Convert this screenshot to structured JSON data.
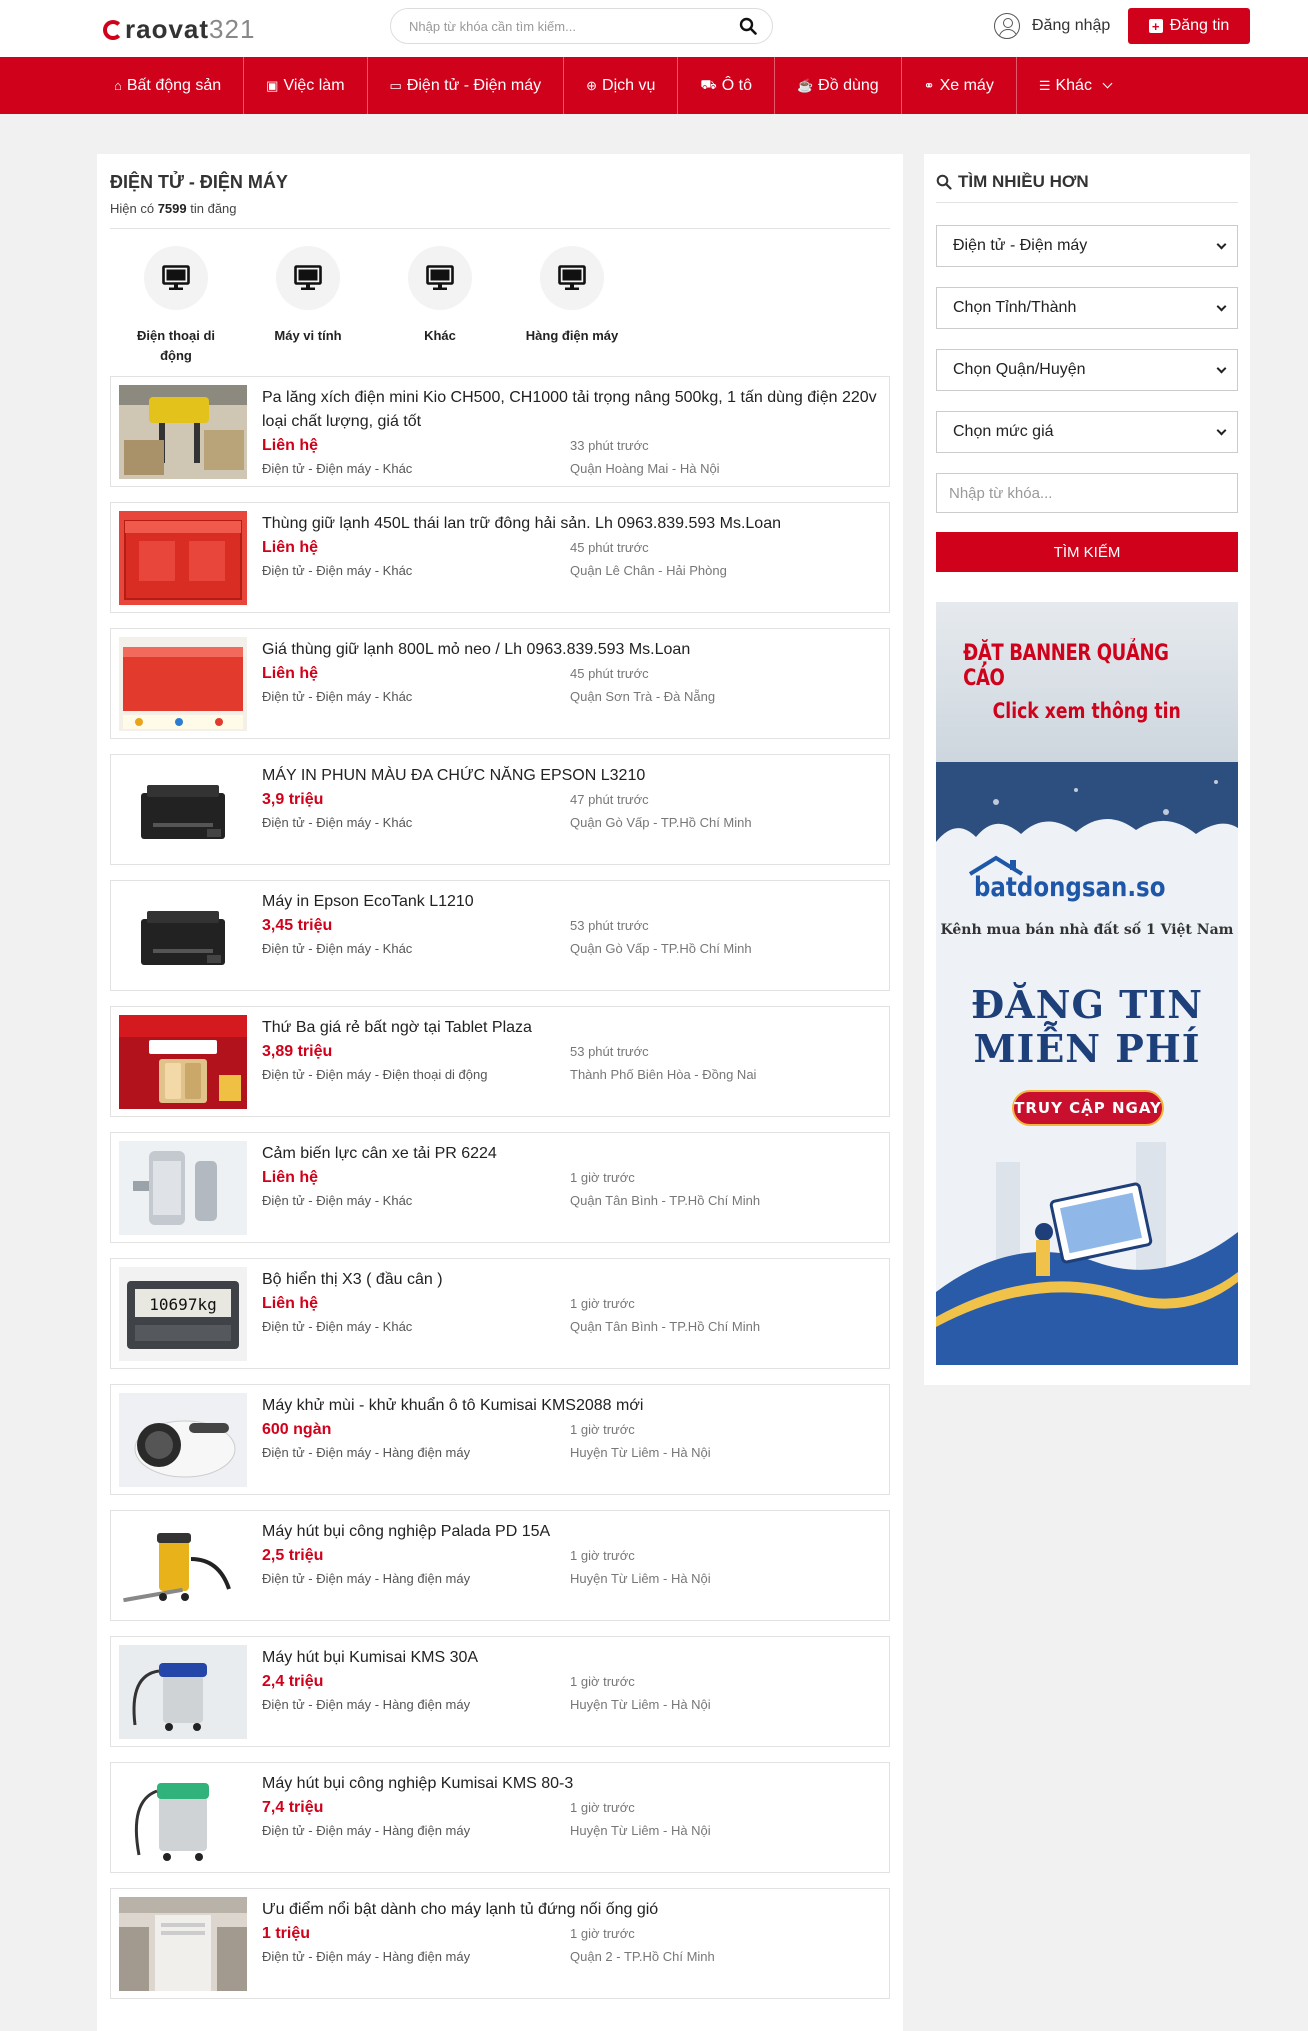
{
  "header": {
    "logo_text": "raovat",
    "logo_num": "321",
    "search_placeholder": "Nhập từ khóa cần tìm kiếm...",
    "login_label": "Đăng nhập",
    "post_label": "Đăng tin"
  },
  "nav": [
    {
      "label": "Bất động sản",
      "icon": "home-icon",
      "glyph": "⌂"
    },
    {
      "label": "Việc làm",
      "icon": "briefcase-icon",
      "glyph": "▣"
    },
    {
      "label": "Điện tử - Điện máy",
      "icon": "monitor-icon",
      "glyph": "▭"
    },
    {
      "label": "Dịch vụ",
      "icon": "globe-icon",
      "glyph": "⊕"
    },
    {
      "label": "Ô tô",
      "icon": "car-icon",
      "glyph": "⛟"
    },
    {
      "label": "Đồ dùng",
      "icon": "cup-icon",
      "glyph": "☕"
    },
    {
      "label": "Xe máy",
      "icon": "motorbike-icon",
      "glyph": "⚭"
    },
    {
      "label": "Khác",
      "icon": "list-icon",
      "glyph": "☰"
    }
  ],
  "main": {
    "title": "ĐIỆN TỬ - ĐIỆN MÁY",
    "count_prefix": "Hiện có",
    "count": "7599",
    "count_suffix": "tin đăng",
    "categories": [
      {
        "label": "Điện thoại di động"
      },
      {
        "label": "Máy vi tính"
      },
      {
        "label": "Khác"
      },
      {
        "label": "Hàng điện máy"
      }
    ],
    "listings": [
      {
        "title": "Pa lăng xích điện mini Kio CH500, CH1000 tải trọng nâng 500kg, 1 tấn dùng điện 220v loại chất lượng, giá tốt",
        "price": "Liên hệ",
        "category": "Điện tử - Điện máy - Khác",
        "time": "33 phút trước",
        "location": "Quận Hoàng Mai - Hà Nội",
        "thumb": "hoist"
      },
      {
        "title": "Thùng giữ lạnh 450L thái lan trữ đông hải sản. Lh 0963.839.593 Ms.Loan",
        "price": "Liên hệ",
        "category": "Điện tử - Điện máy - Khác",
        "time": "45 phút trước",
        "location": "Quận Lê Chân - Hải Phòng",
        "thumb": "redbox"
      },
      {
        "title": "Giá thùng giữ lạnh 800L mỏ neo / Lh 0963.839.593 Ms.Loan",
        "price": "Liên hệ",
        "category": "Điện tử - Điện máy - Khác",
        "time": "45 phút trước",
        "location": "Quận Sơn Trà - Đà Nẵng",
        "thumb": "redbox2"
      },
      {
        "title": "MÁY IN PHUN MÀU ĐA CHỨC NĂNG EPSON L3210",
        "price": "3,9 triệu",
        "category": "Điện tử - Điện máy - Khác",
        "time": "47 phút trước",
        "location": "Quận Gò Vấp - TP.Hồ Chí Minh",
        "thumb": "printer"
      },
      {
        "title": "Máy in Epson EcoTank L1210",
        "price": "3,45 triệu",
        "category": "Điện tử - Điện máy - Khác",
        "time": "53 phút trước",
        "location": "Quận Gò Vấp - TP.Hồ Chí Minh",
        "thumb": "printer"
      },
      {
        "title": "Thứ Ba giá rẻ bất ngờ tại Tablet Plaza",
        "price": "3,89 triệu",
        "category": "Điện tử - Điện máy - Điện thoại di động",
        "time": "53 phút trước",
        "location": "Thành Phố Biên Hòa - Đồng Nai",
        "thumb": "promo"
      },
      {
        "title": "Cảm biến lực cân xe tải PR 6224",
        "price": "Liên hệ",
        "category": "Điện tử - Điện máy - Khác",
        "time": "1 giờ trước",
        "location": "Quận Tân Bình - TP.Hồ Chí Minh",
        "thumb": "sensor"
      },
      {
        "title": "Bộ hiển thị X3 ( đầu cân )",
        "price": "Liên hệ",
        "category": "Điện tử - Điện máy - Khác",
        "time": "1 giờ trước",
        "location": "Quận Tân Bình - TP.Hồ Chí Minh",
        "thumb": "display",
        "thumb_text": "10697kg"
      },
      {
        "title": "Máy khử mùi - khử khuẩn ô tô Kumisai KMS2088 mới",
        "price": "600 ngàn",
        "category": "Điện tử - Điện máy - Hàng điện máy",
        "time": "1 giờ trước",
        "location": "Huyện Từ Liêm - Hà Nội",
        "thumb": "fogger"
      },
      {
        "title": "Máy hút bụi công nghiệp Palada PD 15A",
        "price": "2,5 triệu",
        "category": "Điện tử - Điện máy - Hàng điện máy",
        "time": "1 giờ trước",
        "location": "Huyện Từ Liêm - Hà Nội",
        "thumb": "vacuum-yellow"
      },
      {
        "title": "Máy hút bụi Kumisai KMS 30A",
        "price": "2,4 triệu",
        "category": "Điện tử - Điện máy - Hàng điện máy",
        "time": "1 giờ trước",
        "location": "Huyện Từ Liêm - Hà Nội",
        "thumb": "vacuum-blue"
      },
      {
        "title": "Máy hút bụi công nghiệp Kumisai KMS 80-3",
        "price": "7,4 triệu",
        "category": "Điện tử - Điện máy - Hàng điện máy",
        "time": "1 giờ trước",
        "location": "Huyện Từ Liêm - Hà Nội",
        "thumb": "vacuum-green"
      },
      {
        "title": "Ưu điểm nổi bật dành cho máy lạnh tủ đứng nối ống gió",
        "price": "1 triệu",
        "category": "Điện tử - Điện máy - Hàng điện máy",
        "time": "1 giờ trước",
        "location": "Quận 2 - TP.Hồ Chí Minh",
        "thumb": "aircon"
      }
    ]
  },
  "sidebar": {
    "title": "TÌM NHIỀU HƠN",
    "selects": [
      {
        "value": "Điện tử - Điện máy"
      },
      {
        "value": "Chọn Tỉnh/Thành"
      },
      {
        "value": "Chọn Quận/Huyện"
      },
      {
        "value": "Chọn mức giá"
      }
    ],
    "keyword_placeholder": "Nhập từ khóa...",
    "search_button": "TÌM KIẾM",
    "banner": {
      "line1": "ĐẶT BANNER QUẢNG CÁO",
      "line2": "Click xem thông tin",
      "brand": "batdongsan.so",
      "sub": "Kênh mua bán nhà đất số 1 Việt Nam",
      "big1": "ĐĂNG TIN",
      "big2": "MIỄN PHÍ",
      "cta": "TRUY CẬP NGAY"
    }
  },
  "colors": {
    "brand": "#d0021b",
    "price": "#d0021b"
  }
}
